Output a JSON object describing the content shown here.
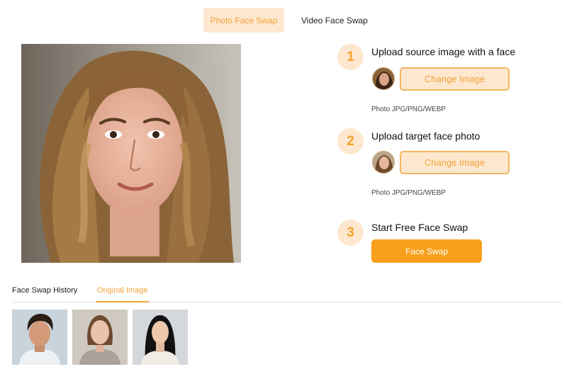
{
  "mode_tabs": [
    {
      "label": "Photo Face Swap",
      "active": true
    },
    {
      "label": "Video Face Swap",
      "active": false
    }
  ],
  "steps": [
    {
      "number": "1",
      "title": "Upload source image with a face",
      "button": "Change Image",
      "formats": "Photo JPG/PNG/WEBP"
    },
    {
      "number": "2",
      "title": "Upload target face photo",
      "button": "Change Image",
      "formats": "Photo JPG/PNG/WEBP"
    },
    {
      "number": "3",
      "title": "Start Free Face Swap",
      "button": "Face Swap"
    }
  ],
  "history_tabs": [
    {
      "label": "Face Swap History",
      "active": false
    },
    {
      "label": "Original Image",
      "active": true
    }
  ],
  "colors": {
    "accent": "#f7a01c",
    "accent_light": "#fde8cf",
    "accent_text": "#f2a23a"
  }
}
